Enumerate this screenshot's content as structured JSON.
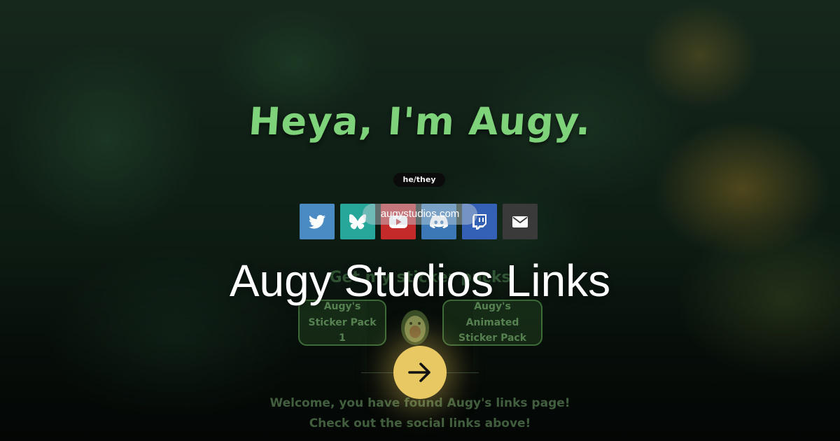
{
  "profile": {
    "heading": "Heya, I'm Augy.",
    "pronouns": "he/they"
  },
  "socials": [
    {
      "name": "Twitter",
      "icon": "twitter-bird-icon",
      "color": "#4a8bc4"
    },
    {
      "name": "Bluesky",
      "icon": "butterfly-icon",
      "color": "#27a69a"
    },
    {
      "name": "YouTube",
      "icon": "play-icon",
      "color": "#c42a2a"
    },
    {
      "name": "Discord",
      "icon": "discord-icon",
      "color": "#3b78b5"
    },
    {
      "name": "Twitch",
      "icon": "twitch-icon",
      "color": "#3460b5"
    },
    {
      "name": "Email",
      "icon": "envelope-icon",
      "color": "#3a3a3a"
    }
  ],
  "link_preview": {
    "url": "augystudios.com",
    "title": "Augy Studios Links"
  },
  "cards": [
    {
      "label": "Augy's Sticker Pack 1"
    },
    {
      "label": "Augy's Animated Sticker Pack"
    }
  ],
  "faded_subheading": "Get my sticker packs",
  "welcome": {
    "line1": "Welcome, you have found Augy's links page!",
    "line2": "Check out the social links above!"
  },
  "colors": {
    "accent_green": "#7ed27a",
    "arrow_button": "#e8c862"
  }
}
